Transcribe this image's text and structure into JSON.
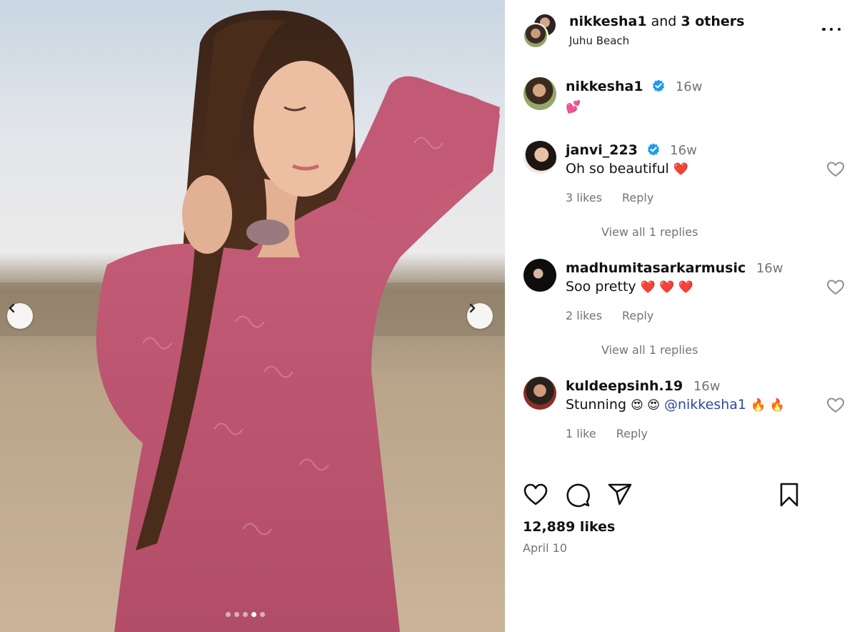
{
  "photo": {
    "carousel_dots": 5,
    "active_dot_index": 3
  },
  "header": {
    "username": "nikkesha1",
    "and_text": "and",
    "others_text": "3 others",
    "location": "Juhu Beach"
  },
  "caption": {
    "username": "nikkesha1",
    "time": "16w",
    "text": "💕"
  },
  "comments": [
    {
      "username": "janvi_223",
      "verified": true,
      "time": "16w",
      "text": "Oh so beautiful",
      "emojis": "❤️",
      "likes": "3 likes",
      "reply_label": "Reply",
      "view_replies": "View all 1 replies"
    },
    {
      "username": "madhumitasarkarmusic",
      "verified": false,
      "time": "16w",
      "text": "Soo pretty",
      "emojis": "❤️ ❤️ ❤️",
      "likes": "2 likes",
      "reply_label": "Reply",
      "view_replies": "View all 1 replies"
    },
    {
      "username": "kuldeepsinh.19",
      "verified": false,
      "time": "16w",
      "text": "Stunning",
      "emojis_before": "😍 😍",
      "mention": "@nikkesha1",
      "emojis_after": "🔥 🔥",
      "likes": "1 like",
      "reply_label": "Reply"
    }
  ],
  "footer": {
    "likes": "12,889 likes",
    "date": "April 10"
  },
  "icons": {
    "like": "heart-icon",
    "comment": "comment-icon",
    "share": "paper-plane-icon",
    "save": "bookmark-icon",
    "more": "more-options-icon",
    "verified": "verified-badge-icon"
  },
  "colors": {
    "verified": "#1d9bf0",
    "secondary_text": "#737373",
    "mention": "#2d4aa3"
  }
}
